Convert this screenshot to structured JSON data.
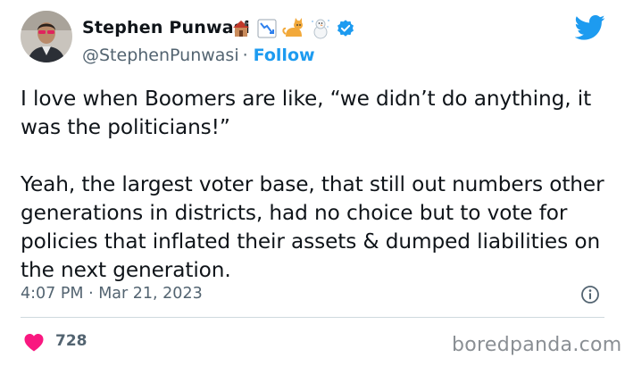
{
  "author": {
    "name": "Stephen Punwasi",
    "handle": "@StephenPunwasi",
    "follow_label": "Follow"
  },
  "tweet": {
    "text": "I love when Boomers are like, “we didn’t do anything, it was the politicians!”\n\nYeah, the largest voter base, that still out numbers other generations in districts, had no choice but to vote for policies that inflated their assets & dumped liabilities on the next generation.",
    "timestamp": "4:07 PM · Mar 21, 2023"
  },
  "stats": {
    "likes": "728"
  },
  "watermark": "boredpanda.com",
  "colors": {
    "accent": "#1d9bf0",
    "heart": "#f91880",
    "muted": "#536471"
  },
  "icons": {
    "header_emojis": [
      "house-icon",
      "chart-down-icon",
      "cat-icon",
      "snowman-icon",
      "verified-badge-icon"
    ],
    "brand": "twitter-bird-icon",
    "info": "info-icon",
    "like": "heart-icon"
  }
}
